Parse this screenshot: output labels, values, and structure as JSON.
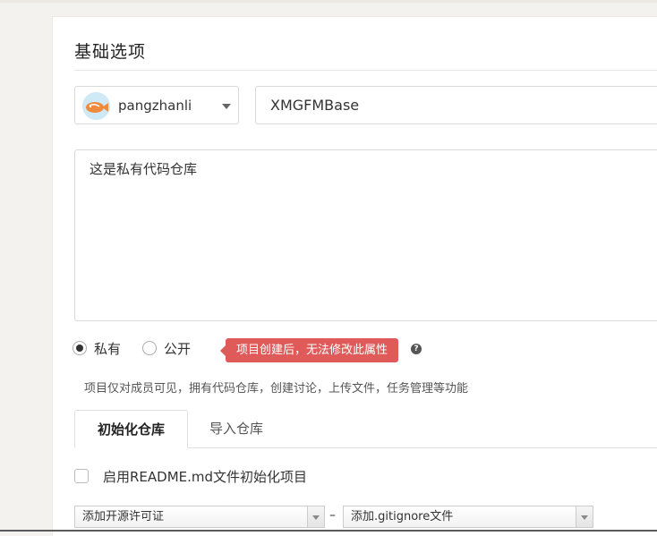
{
  "section": {
    "title": "基础选项"
  },
  "owner": {
    "name": "pangzhanli"
  },
  "repo": {
    "name": "XMGFMBase"
  },
  "description": {
    "value": "这是私有代码仓库"
  },
  "visibility": {
    "private_label": "私有",
    "public_label": "公开",
    "selected": "private",
    "tooltip": "项目创建后，无法修改此属性",
    "hint": "项目仅对成员可见，拥有代码仓库，创建讨论，上传文件，任务管理等功能"
  },
  "tabs": [
    {
      "label": "初始化仓库",
      "active": true
    },
    {
      "label": "导入仓库",
      "active": false
    }
  ],
  "init": {
    "readme_label": "启用README.md文件初始化项目",
    "license_select": "添加开源许可证",
    "separator": "–",
    "gitignore_select": "添加.gitignore文件"
  },
  "colors": {
    "tooltip_bg": "#e05a5a",
    "page_bg": "#f4f2ee"
  }
}
